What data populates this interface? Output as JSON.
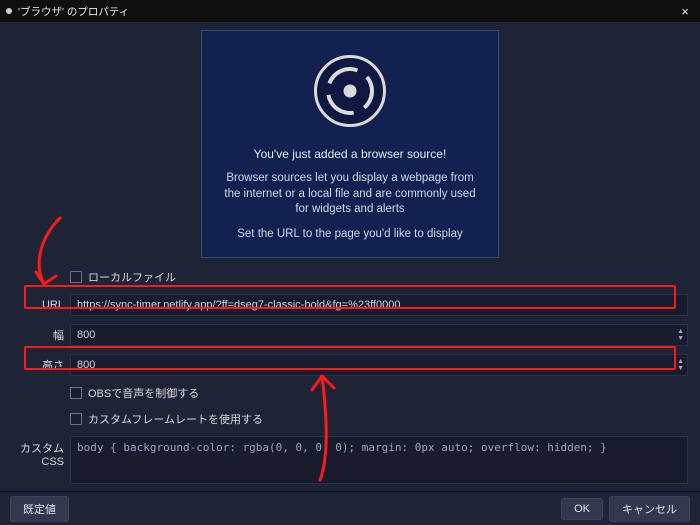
{
  "titlebar": {
    "title": "'ブラウザ' のプロパティ"
  },
  "hero": {
    "line1": "You've just added a browser source!",
    "line2": "Browser sources let you display a webpage from the internet or a local file and are commonly used for widgets and alerts",
    "line3": "Set the URL to the page you'd like to display",
    "icon_name": "obs-logo"
  },
  "form": {
    "local_file": {
      "label": "ローカルファイル",
      "checked": false
    },
    "url": {
      "label": "URL",
      "value": "https://sync-timer.netlify.app/?ff=dseg7-classic-bold&fg=%23ff0000"
    },
    "width": {
      "label": "幅",
      "value": "800"
    },
    "height": {
      "label": "高さ",
      "value": "800"
    },
    "control_audio": {
      "label": "OBSで音声を制御する",
      "checked": false
    },
    "custom_fps": {
      "label": "カスタムフレームレートを使用する",
      "checked": false
    },
    "custom_css": {
      "label": "カスタム CSS",
      "value": "body { background-color: rgba(0, 0, 0, 0); margin: 0px auto; overflow: hidden; }"
    }
  },
  "footer": {
    "defaults": "既定値",
    "ok": "OK",
    "cancel": "キャンセル"
  },
  "colors": {
    "annotation": "#ff1a1a"
  }
}
